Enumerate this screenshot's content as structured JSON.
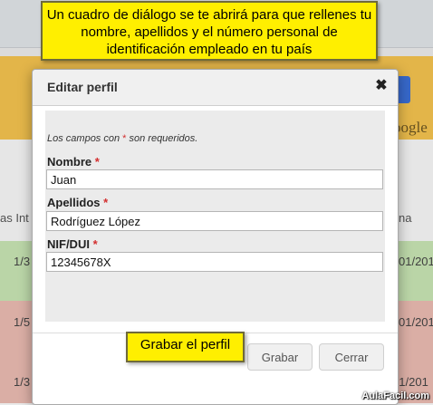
{
  "background": {
    "google_text": "oogle",
    "header_left": "as Int",
    "header_right": "na",
    "rows": [
      {
        "left": "1/3",
        "right": "01/201"
      },
      {
        "left": "1/5",
        "right": "01/201"
      },
      {
        "left": "1/3",
        "mid": "N",
        "right": "10/01/201"
      }
    ]
  },
  "dialog": {
    "title": "Editar perfil",
    "close_glyph": "✖",
    "required_note_prefix": "Los campos con ",
    "required_note_star": "*",
    "required_note_suffix": " son requeridos.",
    "fields": [
      {
        "label": "Nombre",
        "star": "*",
        "value": "Juan"
      },
      {
        "label": "Apellidos",
        "star": "*",
        "value": "Rodríguez López"
      },
      {
        "label": "NIF/DUI",
        "star": "*",
        "value": "12345678X"
      }
    ],
    "buttons": {
      "save": "Grabar",
      "close": "Cerrar"
    }
  },
  "callouts": {
    "top": "Un cuadro de diálogo se te abrirá para que rellenes tu nombre, apellidos y el número personal de identificación empleado en tu país",
    "save": "Grabar el perfil"
  },
  "watermark": "AulaFacil.com",
  "colors": {
    "callout_yellow": "#ffef00",
    "required_star": "#d32f2f",
    "row_green": "#c6e3b2",
    "row_red": "#e8b9b0"
  }
}
